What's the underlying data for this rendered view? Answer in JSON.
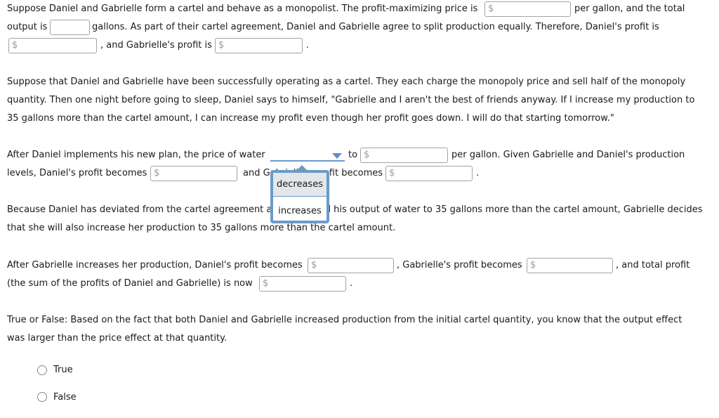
{
  "currency_symbol": "$",
  "p1": {
    "l1a": "Suppose Daniel and Gabrielle form a cartel and behave as a monopolist. The profit-maximizing price is",
    "l1b": "per gallon, and the total",
    "l2a": "output is",
    "l2b": "gallons. As part of their cartel agreement, Daniel and Gabrielle agree to split production equally. Therefore, Daniel's profit is",
    "l3a": ", and Gabrielle's profit is",
    "l3b": "."
  },
  "p2": {
    "l1": "Suppose that Daniel and Gabrielle have been successfully operating as a cartel. They each charge the monopoly price and sell half of the monopoly",
    "l2": "quantity. Then one night before going to sleep, Daniel says to himself, \"Gabrielle and I aren't the best of friends anyway. If I increase my production to",
    "l3": "35 gallons more than the cartel amount, I can increase my profit even though her profit goes down. I will do that starting tomorrow.\""
  },
  "p3": {
    "l1a": "After Daniel implements his new plan, the price of water",
    "l1b": "to",
    "l1c": "per gallon. Given Gabrielle and Daniel's production",
    "l2a": "levels, Daniel's profit becomes",
    "l2b": "and Gabrielle's profit becomes",
    "l2c": ".",
    "dropdown": {
      "selected": "",
      "options": [
        "decreases",
        "increases"
      ],
      "highlighted": "decreases"
    }
  },
  "p4": {
    "l1a": "Because Daniel has deviated from the cartel agreement and increased his output of water to 35 gallons more than the cartel amount, Gabrielle decides",
    "l2": "that she will also increase her production to 35 gallons more than the cartel amount."
  },
  "p5": {
    "l1a": "After Gabrielle increases her production, Daniel's profit becomes",
    "l1b": ", Gabrielle's profit becomes",
    "l1c": ", and total profit",
    "l2a": "(the sum of the profits of Daniel and Gabrielle) is now",
    "l2b": "."
  },
  "p6": {
    "l1": "True or False: Based on the fact that both Daniel and Gabrielle increased production from the initial cartel quantity, you know that the output effect",
    "l2": "was larger than the price effect at that quantity.",
    "options": [
      "True",
      "False"
    ]
  }
}
